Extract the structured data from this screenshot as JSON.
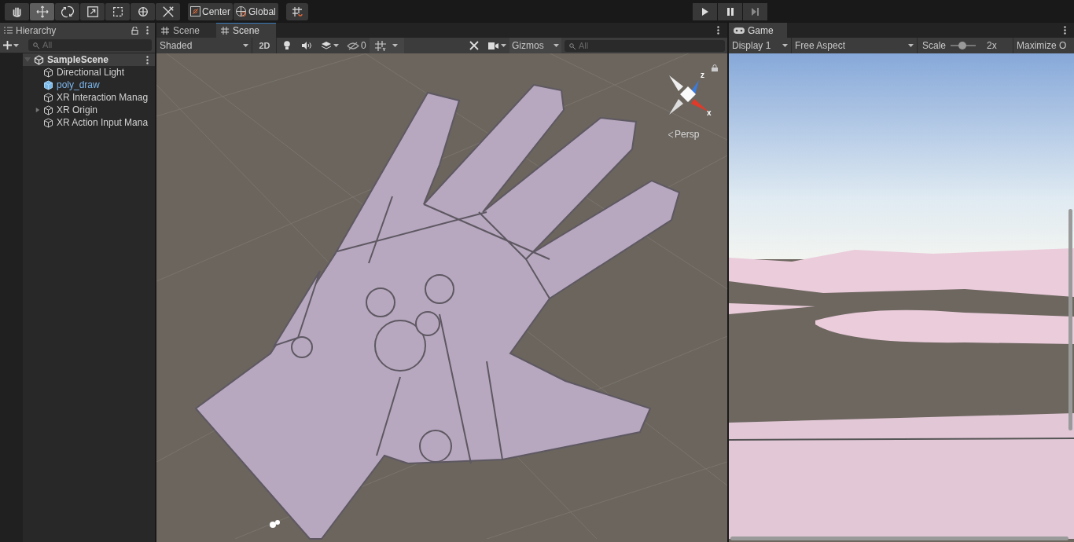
{
  "toolbar": {
    "tools": [
      {
        "kind": "hand",
        "selected": false
      },
      {
        "kind": "move",
        "selected": true
      },
      {
        "kind": "rotate",
        "selected": false
      },
      {
        "kind": "scale",
        "selected": false
      },
      {
        "kind": "rect",
        "selected": false
      },
      {
        "kind": "transform",
        "selected": false
      },
      {
        "kind": "custom",
        "selected": false
      }
    ],
    "pivot": [
      "Center",
      "Global"
    ],
    "play": [
      {
        "kind": "play",
        "selected": false
      },
      {
        "kind": "pause",
        "selected": false
      },
      {
        "kind": "step",
        "selected": false
      }
    ]
  },
  "hierarchy": {
    "title": "Hierarchy",
    "search": {
      "placeholder": "All"
    },
    "scene": "SampleScene",
    "items": [
      {
        "label": "Directional Light",
        "kind": "object"
      },
      {
        "label": "poly_draw",
        "kind": "prefab"
      },
      {
        "label": "XR Interaction Manag",
        "kind": "object"
      },
      {
        "label": "XR Origin",
        "kind": "object",
        "expanded": false
      },
      {
        "label": "XR Action Input Mana",
        "kind": "object"
      }
    ]
  },
  "scene": {
    "tabs": [
      {
        "label": "Scene",
        "selected": false
      },
      {
        "label": "Scene",
        "selected": true
      }
    ],
    "toolbar": {
      "shading": "Shaded",
      "mode_2d": "2D",
      "hidden_count": "0",
      "gizmos": "Gizmos",
      "search": {
        "placeholder": "All"
      }
    },
    "gizmo": {
      "z": "z",
      "x": "x",
      "projection": "Persp"
    }
  },
  "game": {
    "tab": "Game",
    "display": "Display 1",
    "aspect": "Free Aspect",
    "scale_label": "Scale",
    "scale": {
      "level": 0.45
    },
    "scale_value": "2x",
    "maximize": "Maximize O"
  }
}
